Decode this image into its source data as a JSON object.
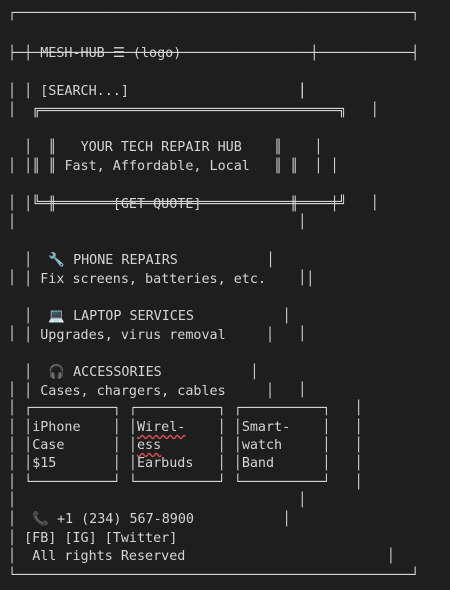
{
  "header": {
    "border_top": "┌─────────────────────────────────────────────────┐",
    "prefix": "│ ",
    "brand": "MESH-HUB",
    "menu_icon": "☰",
    "logo": "(logo)",
    "suffix": "                │",
    "border_bottom": "├─────────────────────────────────────────────────┤"
  },
  "search": {
    "prefix": "│ ",
    "label": "[SEARCH...]",
    "suffix": "                     │"
  },
  "spacer_line": "│                                   │",
  "hero": {
    "border_top": "│  ╔═════════════════════════════════════╗   │",
    "title_prefix": "│  ║   ",
    "title": "YOUR TECH REPAIR HUB",
    "title_suffix": "    ║    │",
    "subtitle_prefix": "│  ║ ",
    "subtitle": "Fast, Affordable, Local",
    "subtitle_suffix": "   ║    │",
    "empty_row": "│  ║                               ║    │",
    "cta_prefix": "│  ║       ",
    "cta": "[GET QUOTE]",
    "cta_suffix": "           ║    │",
    "border_bottom": "│  ╚═════════════════════════════════════╝   │"
  },
  "services": [
    {
      "icon": "wrench-icon",
      "glyph": "🔧",
      "title": "PHONE REPAIRS",
      "desc": "Fix screens, batteries, etc."
    },
    {
      "icon": "laptop-icon",
      "glyph": "💻",
      "title": "LAPTOP SERVICES",
      "desc": "Upgrades, virus removal"
    },
    {
      "icon": "headphones-icon",
      "glyph": "🎧",
      "title": "ACCESSORIES",
      "desc": "Cases, chargers, cables"
    }
  ],
  "service_prefix": "│  ",
  "service_title_gap": " ",
  "service_suffix": "           │",
  "service_desc_prefix": "│ ",
  "service_desc_suffix": "     │",
  "products": {
    "row_top": "│ ┌──────────┐ ┌──────────┐ ┌──────────┐   │",
    "rows": [
      {
        "c1": "iPhone",
        "c2": "Wirel-",
        "c3": "Smart-"
      },
      {
        "c1": "Case",
        "c2": "ess",
        "c3": "watch"
      },
      {
        "c1": "$15",
        "c2": "Earbuds",
        "c3": "Band"
      }
    ],
    "row_bottom": "│ └──────────┘ └──────────┘ └──────────┘   │"
  },
  "footer": {
    "phone_icon": "📞",
    "phone": "+1 (234) 567-8900",
    "social": [
      "[FB]",
      "[IG]",
      "[Twitter]"
    ],
    "copyright": "All rights Reserved",
    "border_bottom": "└─────────────────────────────────────────────────┘"
  }
}
